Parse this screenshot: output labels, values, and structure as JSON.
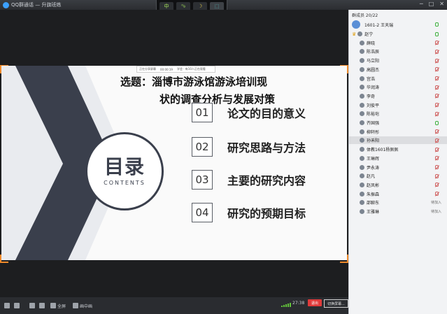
{
  "window": {
    "app_title": "QQ群通话 — 升旗班练",
    "controls": [
      "─",
      "□",
      "✕"
    ]
  },
  "toolstrip": {
    "buttons": [
      {
        "label": "中",
        "icon": "chinese-input-icon"
      },
      {
        "label": "⁰₉",
        "icon": "symbol-icon"
      },
      {
        "label": "☽",
        "icon": "moon-icon"
      },
      {
        "label": "⬚",
        "icon": "keyboard-icon"
      }
    ]
  },
  "slide": {
    "header_left": "正在分享屏幕",
    "header_mid": "00:00:19",
    "header_right": "学会 · 有10人正在观看",
    "title_line1": "选题：淄博市游泳馆游泳培训现",
    "title_line2": "状的调查分析与发展对策",
    "circle_big": "目录",
    "circle_small": "CONTENTS",
    "items": [
      {
        "num": "01",
        "text": "论文的目的意义"
      },
      {
        "num": "02",
        "text": "研究思路与方法"
      },
      {
        "num": "03",
        "text": "主要的研究内容"
      },
      {
        "num": "04",
        "text": "研究的预期目标"
      }
    ],
    "colors": {
      "dark": "#3a3f4c",
      "accent": "#f08a2b"
    }
  },
  "controls": {
    "buttons": [
      {
        "label": "",
        "icon": "microphone-icon"
      },
      {
        "label": "",
        "icon": "speaker-icon"
      },
      {
        "label": "",
        "icon": "share-screen-icon"
      },
      {
        "label": "",
        "icon": "camera-icon"
      },
      {
        "label": "全屏",
        "icon": "fullscreen-icon"
      },
      {
        "label": "画中画",
        "icon": "picture-in-picture-icon"
      }
    ],
    "time": "27:38",
    "hangup_label": "退出",
    "switch_label": "切换屏幕..."
  },
  "panel": {
    "header": "群成员 20/22",
    "host": {
      "name": "1601-2 王天瑞"
    },
    "members": [
      {
        "name": "赵宁",
        "mic": "on",
        "status": ""
      },
      {
        "name": "薛晓",
        "mic": "off",
        "status": ""
      },
      {
        "name": "陈浩辰",
        "mic": "off",
        "status": ""
      },
      {
        "name": "马立阳",
        "mic": "off",
        "status": ""
      },
      {
        "name": "高圆杰",
        "mic": "off",
        "status": ""
      },
      {
        "name": "宫浩",
        "mic": "off",
        "status": ""
      },
      {
        "name": "华润涛",
        "mic": "off",
        "status": ""
      },
      {
        "name": "李奇",
        "mic": "off",
        "status": ""
      },
      {
        "name": "刘俊平",
        "mic": "off",
        "status": ""
      },
      {
        "name": "陈裕垲",
        "mic": "off",
        "status": ""
      },
      {
        "name": "齐国强",
        "mic": "on",
        "status": ""
      },
      {
        "name": "柳轩彤",
        "mic": "off",
        "status": ""
      },
      {
        "name": "孙禾阳",
        "mic": "off",
        "status": ""
      },
      {
        "name": "体教1601杨佩佩",
        "mic": "off",
        "status": ""
      },
      {
        "name": "王琳辉",
        "mic": "off",
        "status": ""
      },
      {
        "name": "尹永涛",
        "mic": "off",
        "status": ""
      },
      {
        "name": "赵凡",
        "mic": "off",
        "status": ""
      },
      {
        "name": "赵凤彬",
        "mic": "off",
        "status": ""
      },
      {
        "name": "朱振森",
        "mic": "off",
        "status": ""
      },
      {
        "name": "邵聊东",
        "mic": "",
        "status": "待加入"
      },
      {
        "name": "王雅琳",
        "mic": "",
        "status": "待加入"
      }
    ]
  }
}
